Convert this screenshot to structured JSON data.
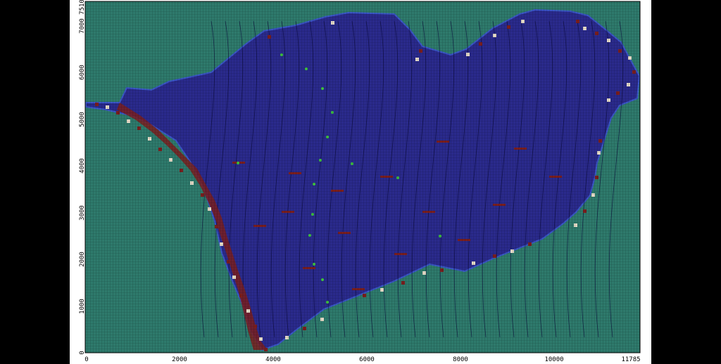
{
  "map": {
    "x_ticks": [
      "0",
      "2000",
      "4000",
      "6000",
      "8000",
      "10000",
      "11785"
    ],
    "y_ticks": [
      "0",
      "1000",
      "2000",
      "3000",
      "4000",
      "5000",
      "6000",
      "7000",
      "7510"
    ],
    "x_extent": [
      0,
      11785
    ],
    "y_extent": [
      0,
      7510
    ],
    "colors": {
      "inactive_cells": "#2e7a6c",
      "active_cells": "#2a2a8c",
      "grid_lines": "#16163e",
      "boundary_light": "#e6dcc8",
      "boundary_dark": "#7a1e1e",
      "wells": "#3ec23e",
      "flow_lines": "#0a0a3a",
      "background": "#000000",
      "frame": "#ffffff"
    }
  }
}
